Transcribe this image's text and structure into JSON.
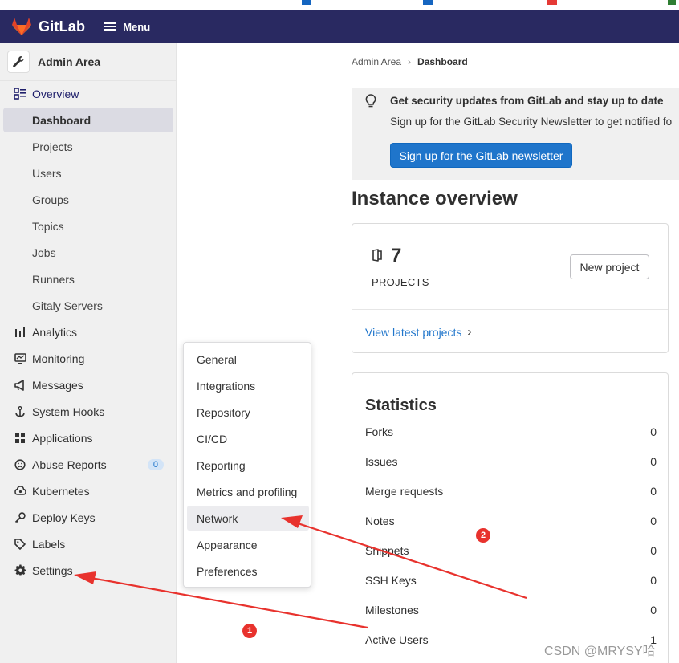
{
  "header": {
    "logo_text": "GitLab",
    "menu_label": "Menu",
    "brand_color": "#292961",
    "logo_color": "#e24329"
  },
  "sidebar": {
    "title": "Admin Area",
    "items": [
      {
        "label": "Overview",
        "icon": "overview-icon"
      },
      {
        "label": "Dashboard"
      },
      {
        "label": "Projects"
      },
      {
        "label": "Users"
      },
      {
        "label": "Groups"
      },
      {
        "label": "Topics"
      },
      {
        "label": "Jobs"
      },
      {
        "label": "Runners"
      },
      {
        "label": "Gitaly Servers"
      },
      {
        "label": "Analytics",
        "icon": "chart-icon"
      },
      {
        "label": "Monitoring",
        "icon": "monitor-icon"
      },
      {
        "label": "Messages",
        "icon": "megaphone-icon"
      },
      {
        "label": "System Hooks",
        "icon": "hook-icon"
      },
      {
        "label": "Applications",
        "icon": "applications-icon"
      },
      {
        "label": "Abuse Reports",
        "icon": "abuse-icon",
        "badge": "0"
      },
      {
        "label": "Kubernetes",
        "icon": "kubernetes-icon"
      },
      {
        "label": "Deploy Keys",
        "icon": "key-icon"
      },
      {
        "label": "Labels",
        "icon": "label-icon"
      },
      {
        "label": "Settings",
        "icon": "gear-icon"
      }
    ]
  },
  "settings_menu": {
    "items": [
      "General",
      "Integrations",
      "Repository",
      "CI/CD",
      "Reporting",
      "Metrics and profiling",
      "Network",
      "Appearance",
      "Preferences"
    ],
    "highlighted": "Network"
  },
  "breadcrumb": {
    "parent": "Admin Area",
    "current": "Dashboard"
  },
  "banner": {
    "title": "Get security updates from GitLab and stay up to date",
    "text": "Sign up for the GitLab Security Newsletter to get notified fo",
    "button": "Sign up for the GitLab newsletter",
    "button_color": "#1f75cb"
  },
  "main": {
    "heading": "Instance overview",
    "projects": {
      "count": "7",
      "label": "PROJECTS",
      "new_button": "New project",
      "link": "View latest projects"
    },
    "statistics": {
      "title": "Statistics",
      "rows": [
        {
          "label": "Forks",
          "value": "0"
        },
        {
          "label": "Issues",
          "value": "0"
        },
        {
          "label": "Merge requests",
          "value": "0"
        },
        {
          "label": "Notes",
          "value": "0"
        },
        {
          "label": "Snippets",
          "value": "0"
        },
        {
          "label": "SSH Keys",
          "value": "0"
        },
        {
          "label": "Milestones",
          "value": "0"
        },
        {
          "label": "Active Users",
          "value": "1"
        }
      ]
    }
  },
  "annotations": {
    "marker_1": "1",
    "marker_2": "2",
    "arrow_color": "#e8322d"
  },
  "watermark": "CSDN @MRYSY哈"
}
